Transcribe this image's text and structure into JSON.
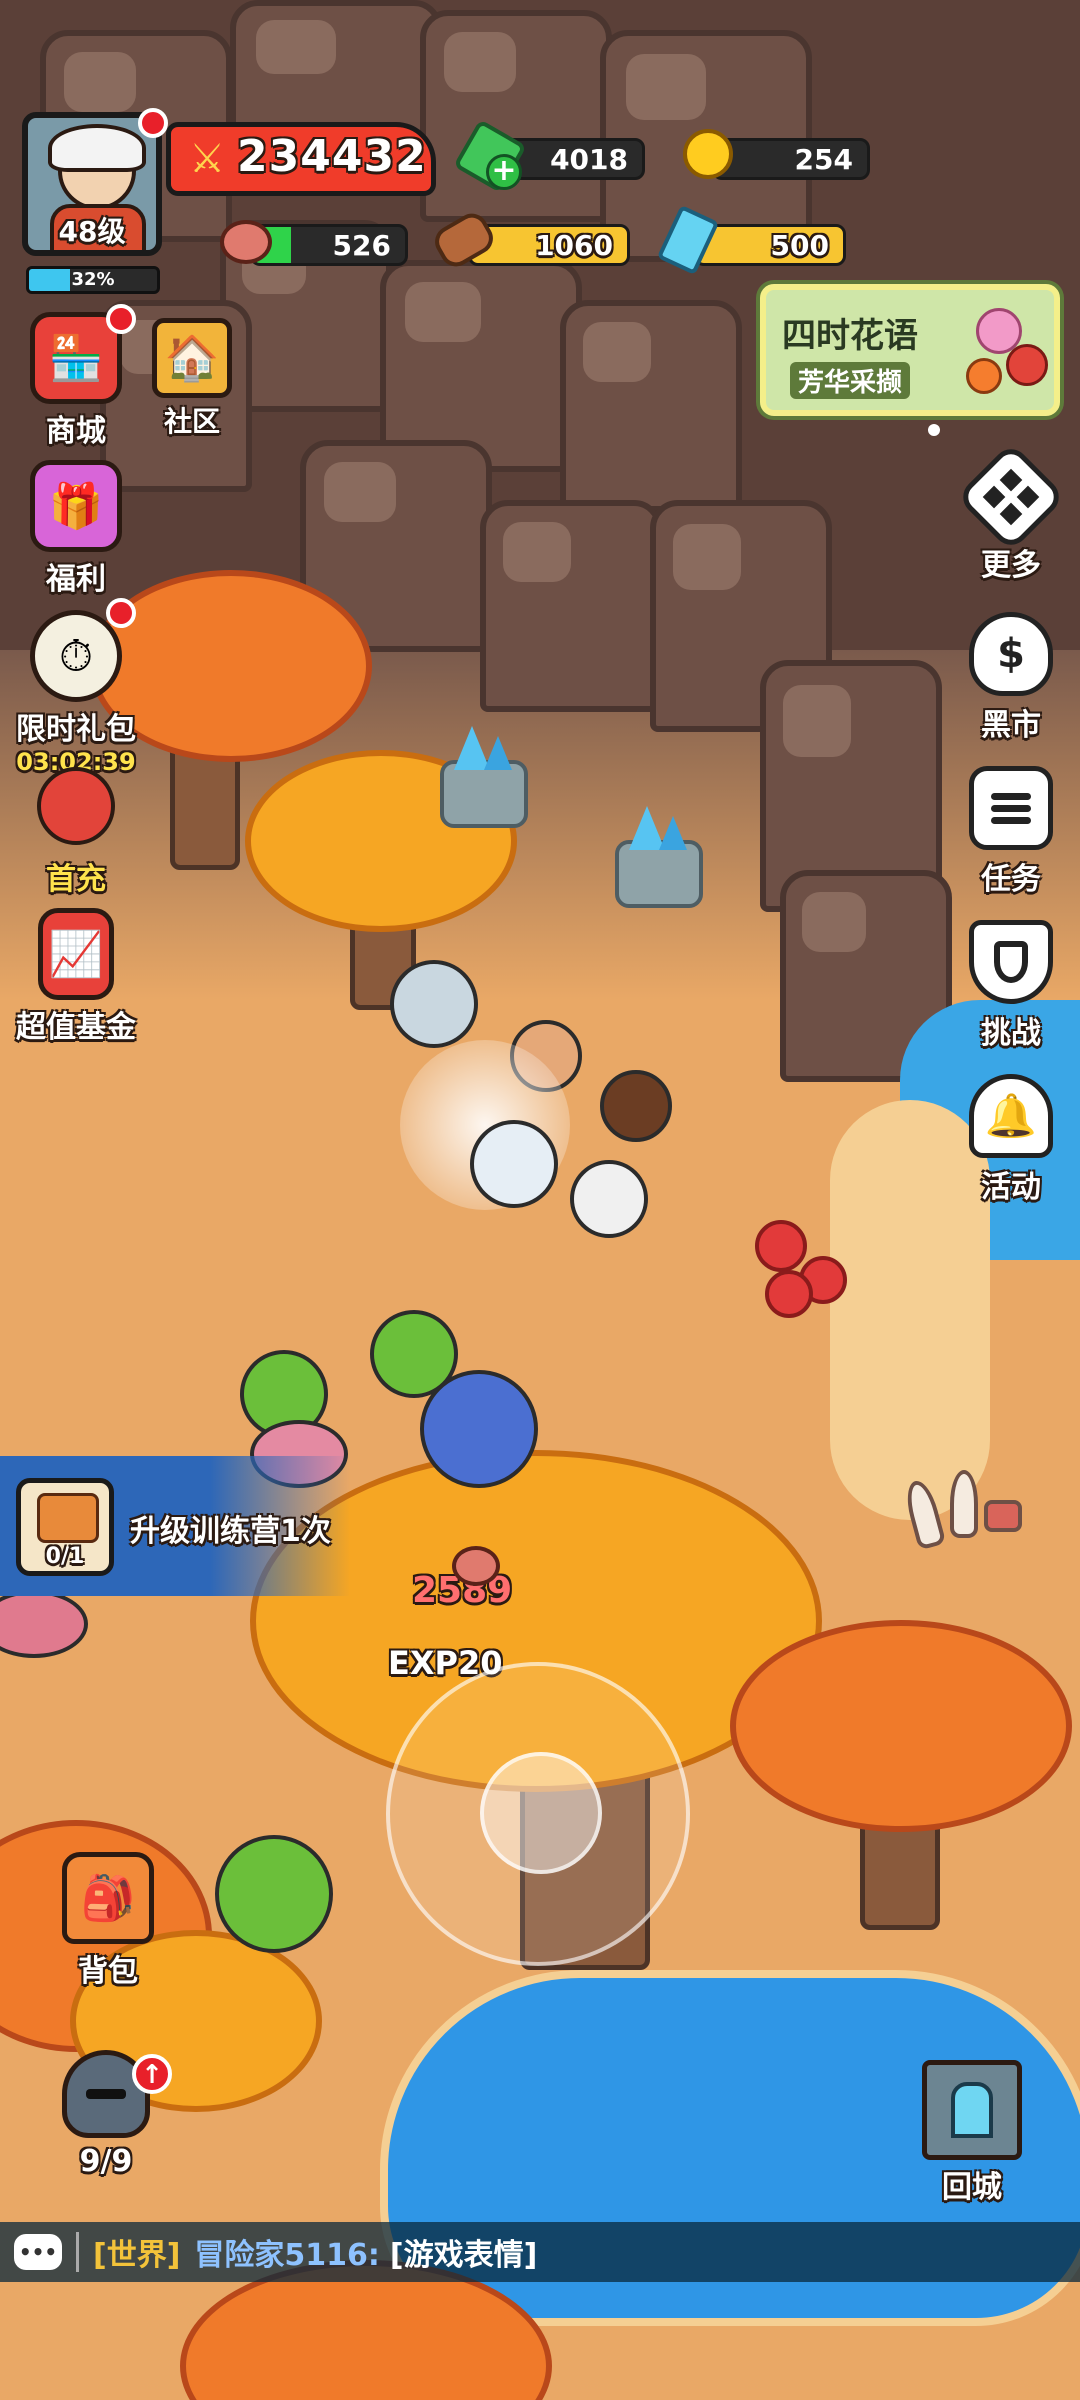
{
  "player": {
    "level": "48级",
    "exp_percent_label": "32%",
    "exp_fraction": 0.32,
    "power": "234432"
  },
  "resources": {
    "gems": "4018",
    "gold": "254",
    "meat": "526",
    "meat_fill": 0.25,
    "wood": "1060",
    "crystal": "500"
  },
  "event_banner": {
    "title": "四时花语",
    "subtitle": "芳华采撷"
  },
  "left_menu": {
    "shop": "商城",
    "community": "社区",
    "welfare": "福利",
    "limited_pack": "限时礼包",
    "limited_timer": "03:02:39",
    "first_recharge": "首充",
    "value_fund": "超值基金"
  },
  "right_menu": {
    "more": "更多",
    "black_market": "黑市",
    "tasks": "任务",
    "challenge": "挑战",
    "events": "活动"
  },
  "quest": {
    "text": "升级训练营1次",
    "progress": "0/1"
  },
  "battle": {
    "damage_text": "2589",
    "exp_text": "EXP20"
  },
  "bottom": {
    "backpack": "背包",
    "heroes_count": "9/9",
    "return_city": "回城"
  },
  "chat": {
    "channel": "[世界]",
    "sender": "冒险家5116:",
    "message": "[游戏表情]"
  },
  "colors": {
    "power_bar": "#f03c2a",
    "exp_bar": "#3ec6ef",
    "meat_bar": "#2fd34a",
    "wood_bar": "#f7c531",
    "crystal_bar": "#f7c531",
    "timer_text": "#ffe34d",
    "chat_channel": "#f3c33a",
    "chat_sender": "#8ec2ff",
    "quest_bg": "#2d67b8"
  }
}
